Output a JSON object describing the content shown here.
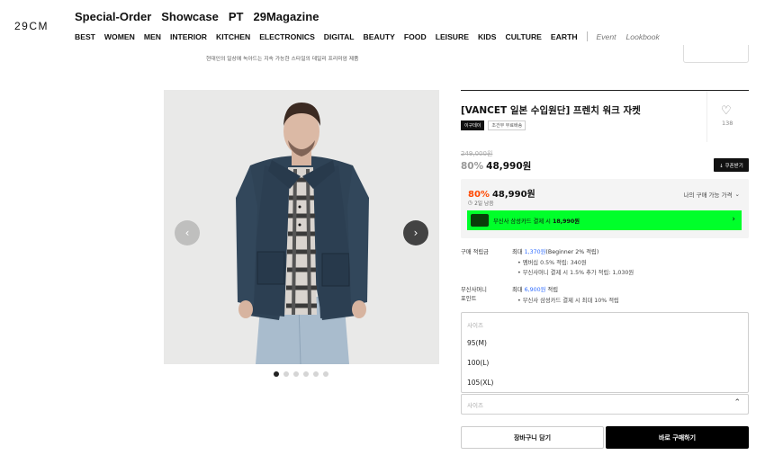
{
  "brand": {
    "logo": "29CM"
  },
  "top_nav": [
    "Special-Order",
    "Showcase",
    "PT",
    "29Magazine"
  ],
  "categories": [
    "BEST",
    "WOMEN",
    "MEN",
    "INTERIOR",
    "KITCHEN",
    "ELECTRONICS",
    "DIGITAL",
    "BEAUTY",
    "FOOD",
    "LEISURE",
    "KIDS",
    "CULTURE",
    "EARTH"
  ],
  "sub_links": [
    "Event",
    "Lookbook"
  ],
  "promo_caption": "현대인의 일상에 녹아드는 지속 가능한 스타일의 데일리 프리미엄 제품",
  "carousel": {
    "prev_icon": "‹",
    "next_icon": "›",
    "slide_count": 6,
    "active_index": 0
  },
  "product": {
    "title": "[VANCET 일본 수입원단] 프렌치 워크 자켓",
    "badges": [
      "이구데이",
      "조건부 무료배송"
    ],
    "like_count": "138",
    "original_price": "249,000원",
    "discount_rate": "80%",
    "price": "48,990원",
    "coupon_label": "↓ 쿠폰받기"
  },
  "benefit": {
    "discount_rate": "80%",
    "price": "48,990원",
    "time_left": "2일 남음",
    "my_price_label": "나의 구매 가능 가격",
    "card_text_prefix": "무신사 삼성카드 결제 시 ",
    "card_text_price": "18,990원",
    "card_color": "#00ff2a"
  },
  "points": {
    "purchase_label": "구매 적립금",
    "purchase_main_prefix": "최대 ",
    "purchase_main_amount": "1,370원",
    "purchase_main_suffix": "(Beginner 2% 적립)",
    "purchase_sub1": "• 멤버십 0.5% 적립: 340원",
    "purchase_sub2": "• 무신사머니 결제 시 1.5% 추가 적립: 1,030원",
    "musinsa_label_1": "무신사머니",
    "musinsa_label_2": "포인트",
    "musinsa_main_prefix": "최대 ",
    "musinsa_main_amount": "6,900원",
    "musinsa_main_suffix": " 적립",
    "musinsa_sub": "• 무신사 삼성카드 결제 시 최대 10% 적립"
  },
  "size_dropdown": {
    "placeholder": "사이즈",
    "options": [
      "95(M)",
      "100(L)",
      "105(XL)"
    ]
  },
  "size_select": {
    "placeholder": "사이즈"
  },
  "actions": {
    "cart_label": "장바구니 담기",
    "buy_label": "바로 구매하기"
  }
}
